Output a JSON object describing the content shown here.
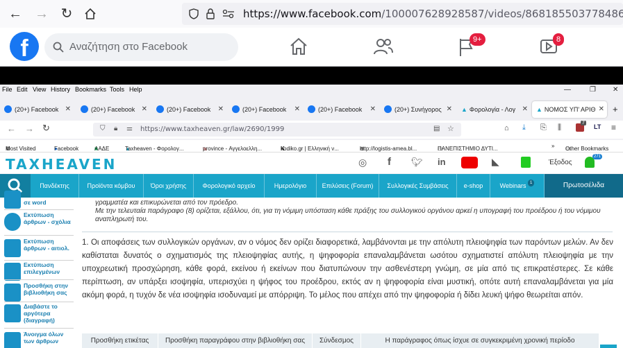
{
  "outer_browser": {
    "url_host": "https://www.facebook.com",
    "url_path": "/100007628928587/videos/868185503778486"
  },
  "facebook": {
    "logo": "f",
    "search_placeholder": "Αναζήτηση στο Facebook",
    "flag_badge": "9+",
    "video_badge": "8"
  },
  "inner_browser": {
    "menu": [
      "File",
      "Edit",
      "View",
      "History",
      "Bookmarks",
      "Tools",
      "Help"
    ],
    "tabs": [
      {
        "label": "(20+) Facebook"
      },
      {
        "label": "(20+) Facebook"
      },
      {
        "label": "(20+) Facebook"
      },
      {
        "label": "(20+) Facebook"
      },
      {
        "label": "(20+) Facebook"
      },
      {
        "label": "(20+) Συνήγορος"
      },
      {
        "label": "Φορολογία - Λογ"
      },
      {
        "label": "ΝΟΜΟΣ ΥΠ' ΑΡΙΘ"
      }
    ],
    "url": "https://www.taxheaven.gr/law/2690/1999",
    "bookmarks": [
      "Most Visited",
      "Facebook",
      "ΑΑΔΕ",
      "Taxheaven - Φορολογ...",
      "province - Αγγελοελλη...",
      "kodiko.gr | Ελληνική ν...",
      "http://logistis-amea.bl...",
      "ΠΑΝΕΠΙΣΤΗΜΙΟ ΔΥΤΙ...",
      "Other Bookmarks"
    ],
    "ext_badge": "7"
  },
  "taxheaven": {
    "logo": "TAXHEAVEN",
    "exit": "Έξοδος",
    "user_badge": "271",
    "nav": [
      "Πανδέκτης",
      "Προϊόντα κόμβου",
      "Όροι χρήσης",
      "Φορολογικό αρχείο",
      "Ημερολόγιο",
      "Επιλύσεις (Forum)",
      "Συλλογικές Συμβάσεις",
      "e-shop",
      "Webinars"
    ],
    "webinars_badge": "1",
    "frontpage": "Πρωτοσέλιδα",
    "sidebar": [
      "σε word",
      "Εκτύπωση άρθρων - σχόλια",
      "Εκτύπωση άρθρων - αιτιολ.",
      "Εκτύπωση επιλεγμένων",
      "Προσθήκη στην βιβλιοθήκη σας",
      "Διαβάστε το αργότερα (διαγραφή)",
      "Άνοιγμα όλων των άρθρων"
    ],
    "quote_lines": [
      "γραμματέα και επικυρώνεται από τον πρόεδρο.",
      "Με την τελευταία παράγραφο (8) ορίζεται, εξάλλου, ότι, για τη νόμιμη υπόσταση κάθε πράξης του συλλογικού οργάνου αρκεί η υπογραφή του προέδρου ή του νόμιμου",
      "αναπληρωτή του."
    ],
    "paragraph": "1. Οι αποφάσεις των συλλογικών οργάνων, αν ο νόμος δεν ορίζει διαφορετικά, λαμβάνονται με την απόλυτη πλειοψηφία των παρόντων μελών. Αν δεν καθίσταται δυνατός ο σχηματισμός της πλειοψηφίας αυτής, η ψηφοφορία επαναλαμβάνεται ωσότου σχηματιστεί απόλυτη πλειοψηφία με την υποχρεωτική προσχώρηση, κάθε φορά, εκείνου ή εκείνων που διατυπώνουν την ασθενέστερη γνώμη, σε μία από τις επικρατέστερες. Σε κάθε περίπτωση, αν υπάρξει ισοψηφία, υπερισχύει η ψήφος του προέδρου, εκτός αν η ψηφοφορία είναι μυστική, οπότε αυτή επαναλαμβάνεται για μία ακόμη φορά, η τυχόν δε νέα ισοψηφία ισοδυναμεί με απόρριψη. Το μέλος που απέχει από την ψηφοφορία ή δίδει λευκή ψήφο θεωρείται απόν.",
    "table_headers": [
      "Προσθήκη ετικέτας",
      "Προσθήκη παραγράφου στην βιβλιοθήκη σας",
      "Σύνδεσμος",
      "Η παράγραφος όπως ίσχυε σε συγκεκριμένη χρονική περίοδο"
    ]
  }
}
